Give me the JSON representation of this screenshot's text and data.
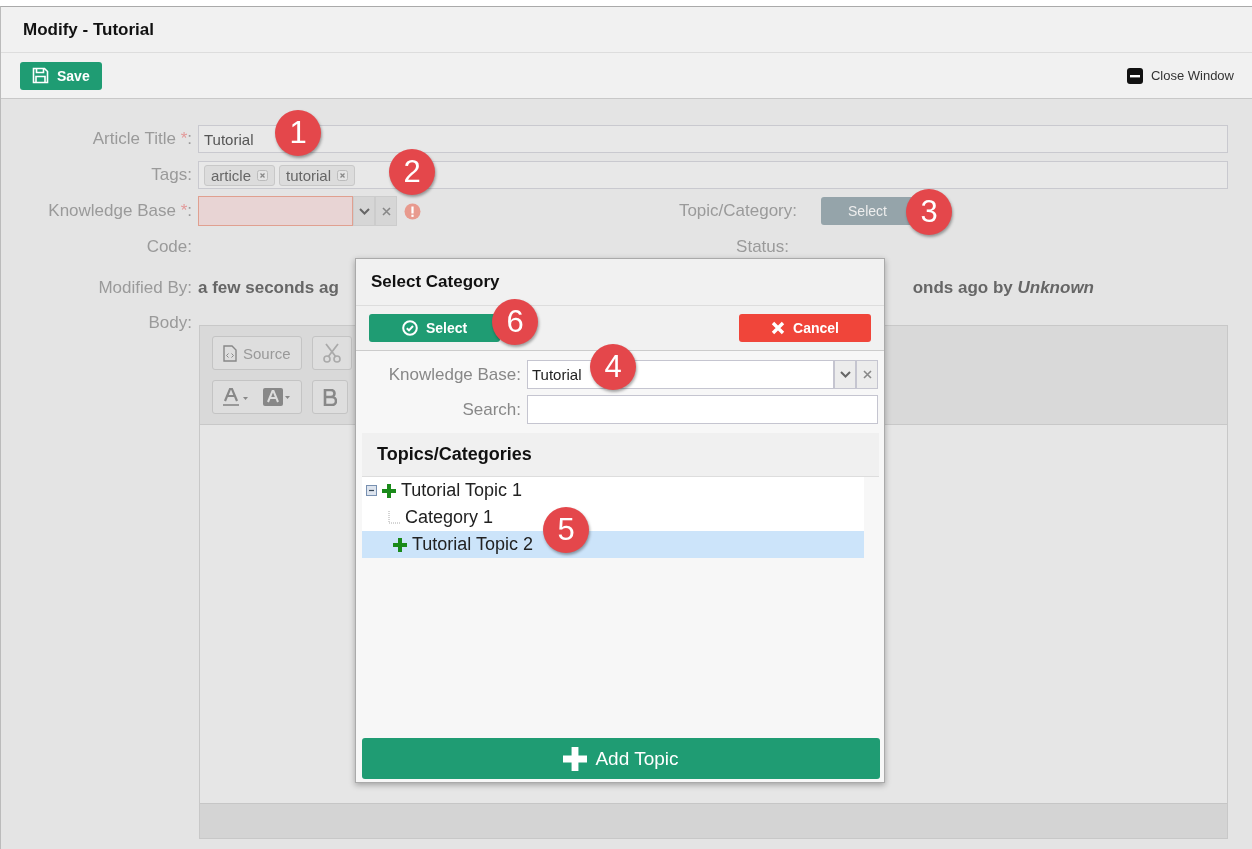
{
  "window": {
    "title": "Modify - Tutorial"
  },
  "toolbar": {
    "save": "Save",
    "close": "Close Window"
  },
  "form": {
    "article_title": {
      "label": "Article Title ",
      "required": "*",
      "colon": ":",
      "value": "Tutorial"
    },
    "tags": {
      "label": "Tags:",
      "items": [
        "article",
        "tutorial"
      ]
    },
    "knowledge_base": {
      "label": "Knowledge Base ",
      "required": "*",
      "colon": ":",
      "invalid": true
    },
    "topic": {
      "label": "Topic/Category:",
      "button": "Select"
    },
    "code": {
      "label": "Code:"
    },
    "status": {
      "label": "Status:"
    },
    "modified_by": {
      "label": "Modified By:",
      "value": "a few seconds ag",
      "value_right": "onds ago by *Unknown*"
    },
    "body": {
      "label": "Body:",
      "tools": [
        "Source"
      ]
    }
  },
  "dialog": {
    "title": "Select Category",
    "select": "Select",
    "cancel": "Cancel",
    "knowledge_base": {
      "label": "Knowledge Base:",
      "value": "Tutorial"
    },
    "search": {
      "label": "Search:"
    },
    "panel_title": "Topics/Categories",
    "tree": [
      {
        "label": "Tutorial Topic 1",
        "kind": "topic",
        "expanded": true,
        "selected": false,
        "children": [
          {
            "label": "Category 1",
            "kind": "category",
            "selected": false
          }
        ]
      },
      {
        "label": "Tutorial Topic 2",
        "kind": "topic",
        "selected": true
      }
    ],
    "add": "Add Topic"
  },
  "callouts": [
    "1",
    "2",
    "3",
    "4",
    "5",
    "6"
  ]
}
